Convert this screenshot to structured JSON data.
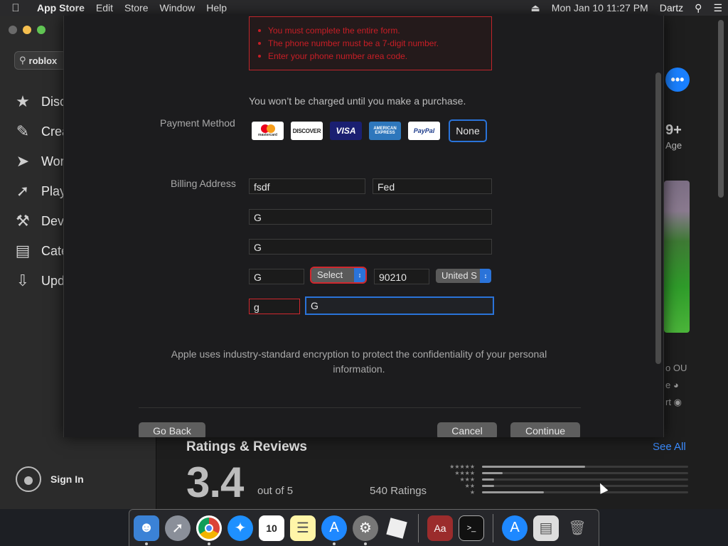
{
  "menubar": {
    "items": [
      "App Store",
      "Edit",
      "Store",
      "Window",
      "Help"
    ],
    "datetime": "Mon Jan 10  11:27 PM",
    "user": "Dartz"
  },
  "sidebar": {
    "search_value": "roblox",
    "items": [
      {
        "label": "Disc",
        "icon": "star-icon"
      },
      {
        "label": "Crea",
        "icon": "brush-icon"
      },
      {
        "label": "Wor",
        "icon": "paper-plane-icon"
      },
      {
        "label": "Play",
        "icon": "rocket-icon"
      },
      {
        "label": "Dev",
        "icon": "hammer-icon"
      },
      {
        "label": "Cate",
        "icon": "categories-icon"
      },
      {
        "label": "Upd",
        "icon": "download-icon"
      }
    ],
    "sign_in": "Sign In"
  },
  "detail": {
    "age_value": "9+",
    "age_label": "Age",
    "clip_text_1": "o OU",
    "clip_text_2": "e",
    "clip_text_3": "rt"
  },
  "ratings": {
    "title": "Ratings & Reviews",
    "see_all": "See All",
    "score": "3.4",
    "out_of": "out of 5",
    "count": "540 Ratings",
    "distribution": [
      0.5,
      0.1,
      0.06,
      0.06,
      0.3
    ]
  },
  "modal": {
    "errors": [
      "You must complete the entire form.",
      "The phone number must be a 7-digit number.",
      "Enter your phone number area code."
    ],
    "charge_note": "You won’t be charged until you make a purchase.",
    "payment_label": "Payment Method",
    "cards": {
      "mastercard": "mastercard",
      "discover": "DISCOVER",
      "visa": "VISA",
      "amex": "AMERICAN EXPRESS",
      "paypal": "PayPal",
      "none": "None"
    },
    "billing_label": "Billing Address",
    "first_name": "fsdf",
    "last_name": "Fed",
    "street": "G",
    "street2": "G",
    "city": "G",
    "state_select": "Select",
    "zip": "90210",
    "country_select": "United S",
    "area_code": "g",
    "phone": "G",
    "secure_note": "Apple uses industry-standard encryption to protect the confidentiality of your personal information.",
    "buttons": {
      "go_back": "Go Back",
      "cancel": "Cancel",
      "continue": "Continue"
    }
  }
}
